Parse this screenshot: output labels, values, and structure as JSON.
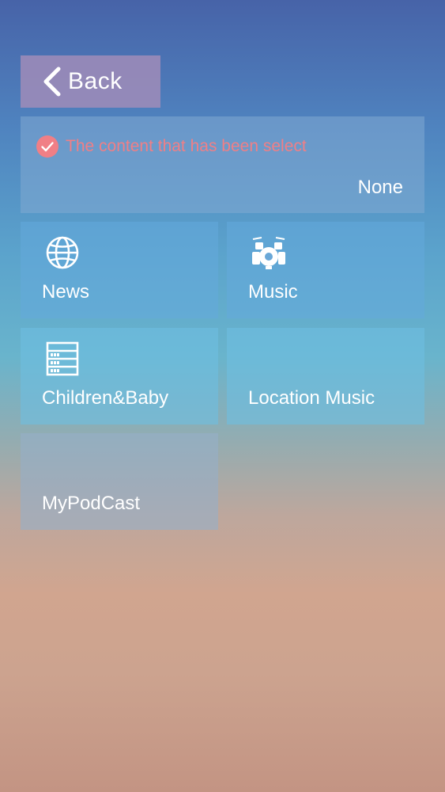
{
  "header": {
    "back_label": "Back"
  },
  "selection": {
    "title": "The content that has been select",
    "value": "None",
    "accent_color": "#f07f86"
  },
  "categories": [
    {
      "id": "news",
      "label": "News",
      "icon": "globe-icon"
    },
    {
      "id": "music",
      "label": "Music",
      "icon": "drum-kit-icon"
    },
    {
      "id": "children",
      "label": "Children&Baby",
      "icon": "shelf-icon"
    },
    {
      "id": "location",
      "label": "Location Music",
      "icon": ""
    },
    {
      "id": "podcast",
      "label": "MyPodCast",
      "icon": ""
    }
  ]
}
